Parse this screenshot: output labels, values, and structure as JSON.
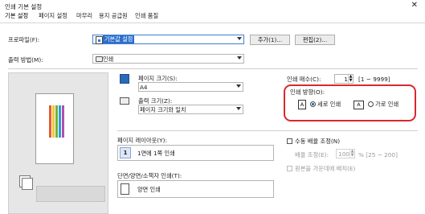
{
  "window": {
    "title": "인쇄 기본 설정",
    "close_glyph": "✕"
  },
  "tabs": [
    {
      "label": "기본 설정"
    },
    {
      "label": "페이지 설정"
    },
    {
      "label": "마무리"
    },
    {
      "label": "용지 공급원"
    },
    {
      "label": "인쇄 품질"
    }
  ],
  "profile": {
    "label": "프로파일(F):",
    "value": "기본값 설정",
    "add_button": "추가(1)...",
    "edit_button": "편집(2)..."
  },
  "output": {
    "label": "출력 방법(M):",
    "value": "인쇄"
  },
  "page_size": {
    "label": "페이지 크기(S):",
    "value": "A4"
  },
  "output_size": {
    "label": "출력 크기(Z):",
    "value": "페이지 크기와 일치"
  },
  "copies": {
    "label": "인쇄 매수(C):",
    "value": "1",
    "range": "[1 ~ 9999]"
  },
  "orientation": {
    "label": "인쇄 방향(O):",
    "portrait": "세로 인쇄",
    "landscape": "가로 인쇄",
    "selected": "portrait"
  },
  "layout": {
    "label": "페이지 레이아웃(Y):",
    "value": "1면에 1쪽 인쇄",
    "icon_text": "1"
  },
  "manual_scaling": {
    "label": "수동 배율 조정(N)",
    "checked": false
  },
  "scale": {
    "label": "배율 조정(E):",
    "value": "100",
    "range": "% [25 ~ 200]"
  },
  "center": {
    "label": "원본을 가운데에 배치(E)"
  },
  "duplex": {
    "label": "단면/양면/소책자 인쇄(T):",
    "value": "양면 인쇄"
  },
  "colors": {
    "accent": "#1a5fb4",
    "highlight": "#d9292e"
  }
}
